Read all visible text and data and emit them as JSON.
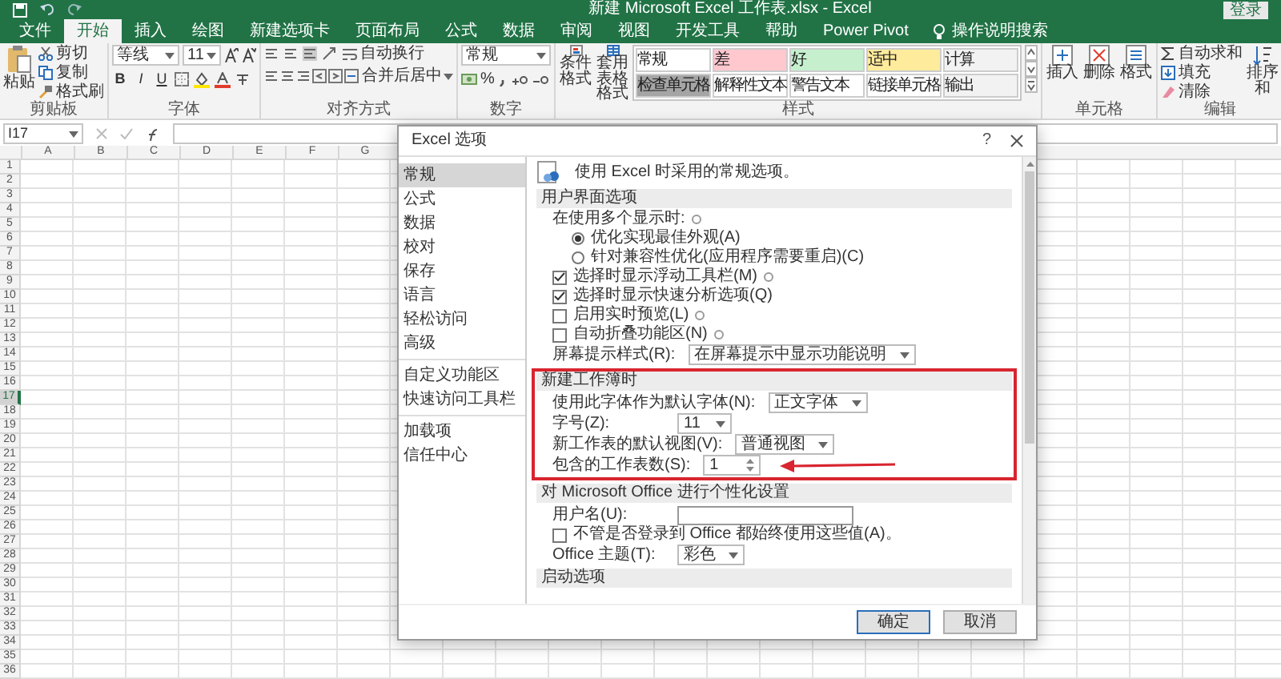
{
  "window": {
    "title": "新建 Microsoft Excel 工作表.xlsx - Excel",
    "login_button": "登录"
  },
  "tabs": [
    {
      "label": "文件",
      "selected": false
    },
    {
      "label": "开始",
      "selected": true
    },
    {
      "label": "插入",
      "selected": false
    },
    {
      "label": "绘图",
      "selected": false
    },
    {
      "label": "新建选项卡",
      "selected": false
    },
    {
      "label": "页面布局",
      "selected": false
    },
    {
      "label": "公式",
      "selected": false
    },
    {
      "label": "数据",
      "selected": false
    },
    {
      "label": "审阅",
      "selected": false
    },
    {
      "label": "视图",
      "selected": false
    },
    {
      "label": "开发工具",
      "selected": false
    },
    {
      "label": "帮助",
      "selected": false
    },
    {
      "label": "Power Pivot",
      "selected": false
    }
  ],
  "tell_me": "操作说明搜索",
  "ribbon": {
    "clipboard": {
      "paste": "粘贴",
      "items": [
        "剪切",
        "复制",
        "格式刷"
      ],
      "label": "剪贴板"
    },
    "font": {
      "name": "等线",
      "size": "11",
      "styles": [
        "B",
        "I",
        "U"
      ],
      "label": "字体"
    },
    "alignment": {
      "wrap": "自动换行",
      "merge": "合并后居中",
      "label": "对齐方式"
    },
    "number": {
      "format": "常规",
      "percent": "%",
      "label": "数字"
    },
    "styles": {
      "conditional": "条件格式",
      "table": "套用表格格式",
      "gallery": [
        {
          "label": "常规",
          "color": "#ffffff"
        },
        {
          "label": "差",
          "color": "#ffc7ce"
        },
        {
          "label": "好",
          "color": "#c6efce"
        },
        {
          "label": "适中",
          "color": "#ffeb9c"
        },
        {
          "label": "计算",
          "color": "#f2f2f2"
        },
        {
          "label": "检查单元格",
          "color": "#a5a5a5"
        },
        {
          "label": "解释性文本",
          "color": "#ffffff"
        },
        {
          "label": "警告文本",
          "color": "#ffffff"
        },
        {
          "label": "链接单元格",
          "color": "#ffffff"
        },
        {
          "label": "输出",
          "color": "#f2f2f2"
        }
      ],
      "label": "样式"
    },
    "cells": {
      "items": [
        "插入",
        "删除",
        "格式"
      ],
      "label": "单元格"
    },
    "editing": {
      "items": [
        "自动求和",
        "填充",
        "清除"
      ],
      "sort": "排序和",
      "label": "编辑"
    }
  },
  "formula_bar": {
    "name_box": "I17"
  },
  "sheet": {
    "columns": [
      "A",
      "B",
      "C",
      "D",
      "E",
      "F",
      "G"
    ],
    "rows": [
      {
        "label": "1",
        "selected": false
      },
      {
        "label": "2",
        "selected": false
      },
      {
        "label": "3",
        "selected": false
      },
      {
        "label": "4",
        "selected": false
      },
      {
        "label": "5",
        "selected": false
      },
      {
        "label": "6",
        "selected": false
      },
      {
        "label": "7",
        "selected": false
      },
      {
        "label": "8",
        "selected": false
      },
      {
        "label": "9",
        "selected": false
      },
      {
        "label": "10",
        "selected": false
      },
      {
        "label": "11",
        "selected": false
      },
      {
        "label": "12",
        "selected": false
      },
      {
        "label": "13",
        "selected": false
      },
      {
        "label": "14",
        "selected": false
      },
      {
        "label": "15",
        "selected": false
      },
      {
        "label": "16",
        "selected": false
      },
      {
        "label": "17",
        "selected": true
      },
      {
        "label": "18",
        "selected": false
      },
      {
        "label": "19",
        "selected": false
      },
      {
        "label": "20",
        "selected": false
      },
      {
        "label": "21",
        "selected": false
      },
      {
        "label": "22",
        "selected": false
      },
      {
        "label": "23",
        "selected": false
      },
      {
        "label": "24",
        "selected": false
      },
      {
        "label": "25",
        "selected": false
      },
      {
        "label": "26",
        "selected": false
      },
      {
        "label": "27",
        "selected": false
      },
      {
        "label": "28",
        "selected": false
      },
      {
        "label": "29",
        "selected": false
      },
      {
        "label": "30",
        "selected": false
      },
      {
        "label": "31",
        "selected": false
      },
      {
        "label": "32",
        "selected": false
      },
      {
        "label": "33",
        "selected": false
      },
      {
        "label": "34",
        "selected": false
      },
      {
        "label": "35",
        "selected": false
      },
      {
        "label": "36",
        "selected": false
      }
    ]
  },
  "dialog": {
    "title": "Excel 选项",
    "help": "?",
    "sidebar": [
      {
        "items": [
          {
            "label": "常规",
            "selected": true
          },
          {
            "label": "公式",
            "selected": false
          },
          {
            "label": "数据",
            "selected": false
          },
          {
            "label": "校对",
            "selected": false
          },
          {
            "label": "保存",
            "selected": false
          },
          {
            "label": "语言",
            "selected": false
          },
          {
            "label": "轻松访问",
            "selected": false
          },
          {
            "label": "高级",
            "selected": false
          }
        ]
      },
      {
        "items": [
          {
            "label": "自定义功能区",
            "selected": false
          },
          {
            "label": "快速访问工具栏",
            "selected": false
          }
        ]
      },
      {
        "items": [
          {
            "label": "加载项",
            "selected": false
          },
          {
            "label": "信任中心",
            "selected": false
          }
        ]
      }
    ],
    "intro": "使用 Excel 时采用的常规选项。",
    "sections": [
      {
        "title": "用户界面选项",
        "highlighted": false,
        "items": [
          {
            "kind": "label",
            "label": "在使用多个显示时:",
            "info": true
          },
          {
            "kind": "radio",
            "label": "优化实现最佳外观(A)",
            "selected": true
          },
          {
            "kind": "radio",
            "label": "针对兼容性优化(应用程序需要重启)(C)",
            "selected": false
          },
          {
            "kind": "checkbox",
            "label": "选择时显示浮动工具栏(M)",
            "checked": true,
            "info": true
          },
          {
            "kind": "checkbox",
            "label": "选择时显示快速分析选项(Q)",
            "checked": true
          },
          {
            "kind": "checkbox",
            "label": "启用实时预览(L)",
            "checked": false,
            "info": true
          },
          {
            "kind": "checkbox",
            "label": "自动折叠功能区(N)",
            "checked": false,
            "info": true
          },
          {
            "kind": "select",
            "label": "屏幕提示样式(R):",
            "value": "在屏幕提示中显示功能说明"
          }
        ]
      },
      {
        "title": "新建工作簿时",
        "highlighted": true,
        "items": [
          {
            "kind": "select",
            "label": "使用此字体作为默认字体(N):",
            "value": "正文字体"
          },
          {
            "kind": "select",
            "label": "字号(Z):",
            "value": "11"
          },
          {
            "kind": "select",
            "label": "新工作表的默认视图(V):",
            "value": "普通视图"
          },
          {
            "kind": "spin",
            "label": "包含的工作表数(S):",
            "value": "1",
            "arrow": true
          }
        ]
      },
      {
        "title": "对 Microsoft Office 进行个性化设置",
        "highlighted": false,
        "items": [
          {
            "kind": "input",
            "label": "用户名(U):"
          },
          {
            "kind": "checkbox",
            "label": "不管是否登录到 Office 都始终使用这些值(A)。",
            "checked": false
          },
          {
            "kind": "select",
            "label": "Office 主题(T):",
            "value": "彩色"
          }
        ]
      },
      {
        "title": "启动选项",
        "highlighted": false
      }
    ],
    "buttons": [
      {
        "label": "确定",
        "default": true
      },
      {
        "label": "取消",
        "default": false
      }
    ]
  }
}
